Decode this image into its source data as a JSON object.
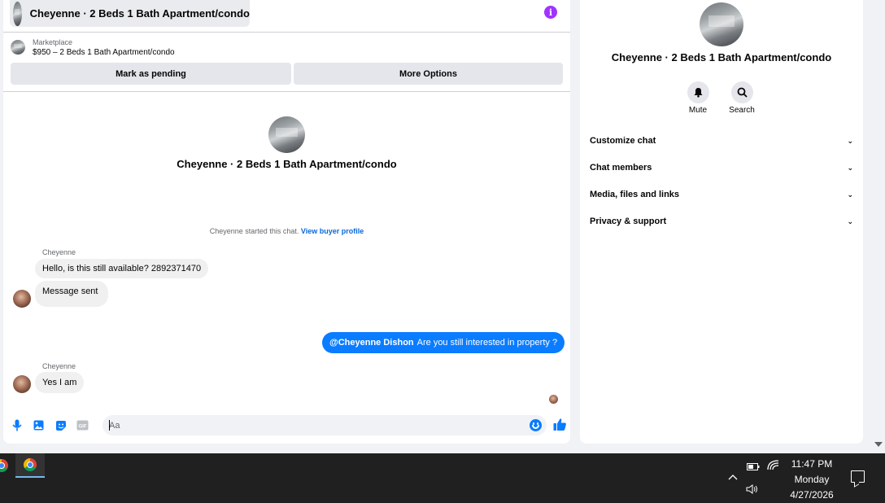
{
  "header": {
    "title": "Cheyenne · 2 Beds 1 Bath Apartment/condo"
  },
  "listing": {
    "label": "Marketplace",
    "price_line": "$950 – 2 Beds 1 Bath Apartment/condo"
  },
  "actions": {
    "pending_label": "Mark as pending",
    "more_label": "More Options"
  },
  "conversation": {
    "title": "Cheyenne · 2 Beds 1 Bath Apartment/condo",
    "started_text": "Cheyenne started this chat.",
    "view_profile_link": "View buyer profile",
    "messages": [
      {
        "sender": "Cheyenne",
        "text": "Hello, is this still available? 2892371470"
      },
      {
        "text": "Message sent"
      },
      {
        "mention": "@Cheyenne Dishon",
        "text": "Are you still interested in property ?"
      },
      {
        "sender": "Cheyenne",
        "text": "Yes I am"
      }
    ]
  },
  "composer": {
    "placeholder": "Aa"
  },
  "side": {
    "title": "Cheyenne · 2 Beds 1 Bath Apartment/condo",
    "mute_label": "Mute",
    "search_label": "Search",
    "menu": [
      {
        "label": "Customize chat"
      },
      {
        "label": "Chat members"
      },
      {
        "label": "Media, files and links"
      },
      {
        "label": "Privacy & support"
      }
    ]
  },
  "taskbar": {
    "time": "11:47 PM",
    "day": "Monday",
    "date": "4/27/2026"
  },
  "colors": {
    "accent": "#0a7cff",
    "info": "#a033ff",
    "link": "#0a68d8"
  }
}
